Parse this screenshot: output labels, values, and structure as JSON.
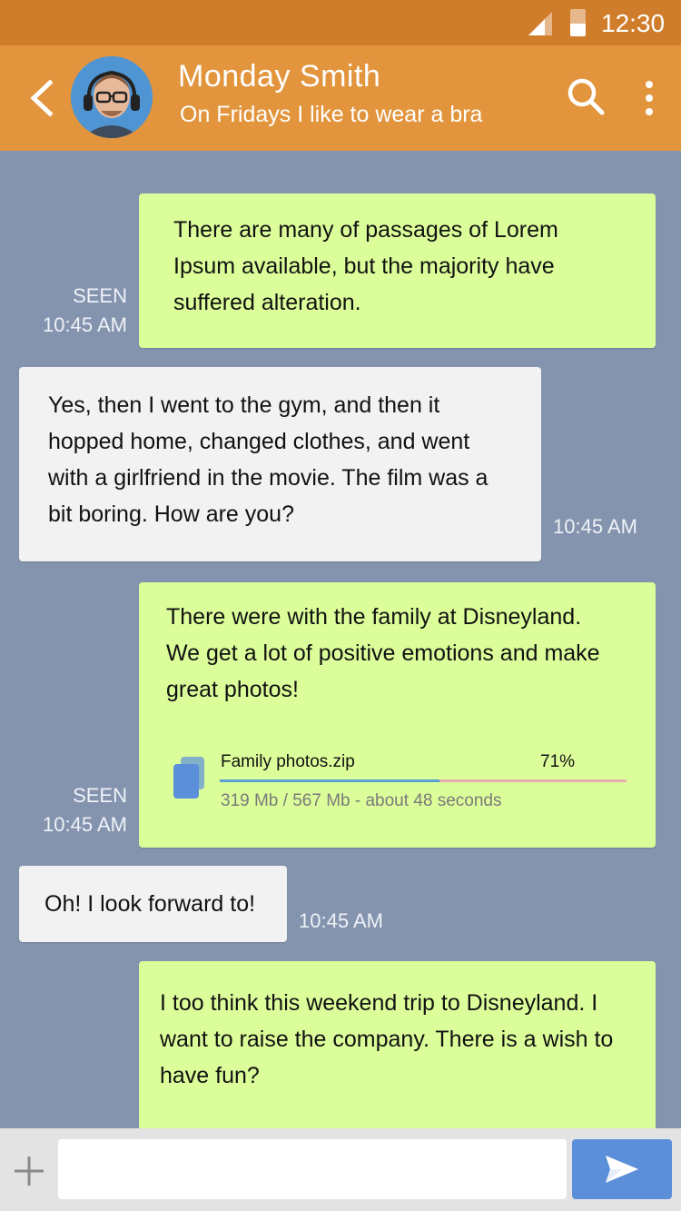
{
  "status_bar": {
    "time": "12:30"
  },
  "header": {
    "contact_name": "Monday Smith",
    "contact_status": "On Fridays I like to wear a bra"
  },
  "messages": [
    {
      "direction": "out",
      "text": "There are many  of passages of Lorem Ipsum available, but the majority have suffered alteration.",
      "seen": "SEEN",
      "time": "10:45 AM"
    },
    {
      "direction": "in",
      "text": "Yes, then I went to the gym, and then it hopped home, changed clothes, and went with a girlfriend in the movie. The film was a bit boring. How are you?",
      "time": "10:45 AM"
    },
    {
      "direction": "out",
      "text": "There were with the family at Disneyland. We get a lot of positive emotions and make great photos!",
      "seen": "SEEN",
      "time": "10:45 AM",
      "attachment": {
        "name": "Family photos.zip",
        "percent": "71%",
        "progress": 0.54,
        "detail": "319 Mb / 567 Mb - about 48 seconds"
      }
    },
    {
      "direction": "in",
      "text": "Oh! I look forward to!",
      "time": "10:45 AM"
    },
    {
      "direction": "out",
      "text": "I too think this weekend trip to Disneyland. I want to raise the company. There is a wish to have fun?"
    }
  ],
  "composer": {
    "placeholder": ""
  },
  "colors": {
    "status_bar": "#d07d2b",
    "app_bar": "#e2953d",
    "background": "#8594ae",
    "outgoing_bubble": "#dcfe9a",
    "incoming_bubble": "#f2f2f2",
    "send_button": "#5b8fd9"
  },
  "icons": [
    "signal-icon",
    "battery-icon",
    "back-arrow-icon",
    "search-icon",
    "more-vert-icon",
    "file-icon",
    "plus-icon",
    "send-icon"
  ]
}
